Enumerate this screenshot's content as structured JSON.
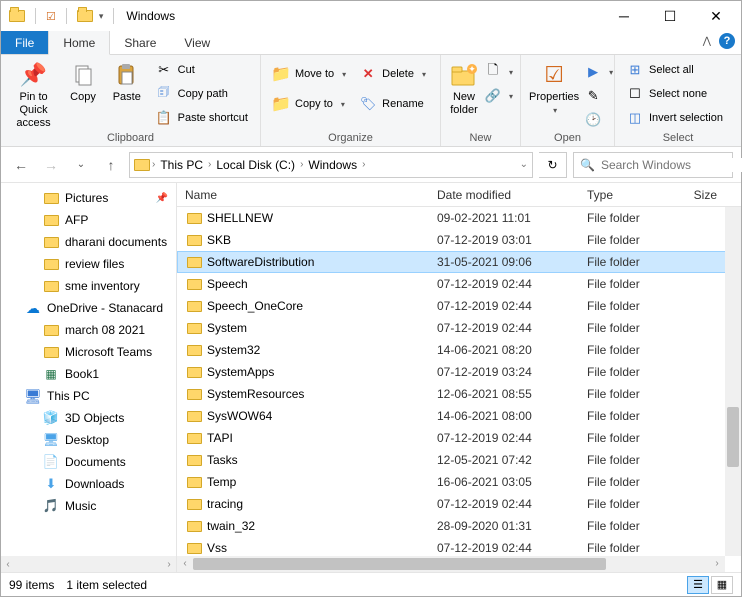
{
  "window": {
    "title": "Windows"
  },
  "tabs": {
    "file": "File",
    "home": "Home",
    "share": "Share",
    "view": "View"
  },
  "ribbon": {
    "clipboard": {
      "label": "Clipboard",
      "pin": "Pin to Quick access",
      "copy": "Copy",
      "paste": "Paste",
      "cut": "Cut",
      "copy_path": "Copy path",
      "paste_shortcut": "Paste shortcut"
    },
    "organize": {
      "label": "Organize",
      "move_to": "Move to",
      "copy_to": "Copy to",
      "delete": "Delete",
      "rename": "Rename"
    },
    "new": {
      "label": "New",
      "new_folder": "New folder"
    },
    "open": {
      "label": "Open",
      "properties": "Properties"
    },
    "select": {
      "label": "Select",
      "select_all": "Select all",
      "select_none": "Select none",
      "invert": "Invert selection"
    }
  },
  "breadcrumb": {
    "this_pc": "This PC",
    "local_disk": "Local Disk (C:)",
    "windows": "Windows"
  },
  "search": {
    "placeholder": "Search Windows"
  },
  "sidebar": {
    "items": [
      {
        "label": "Pictures",
        "icon": "folder",
        "level": 2,
        "pinned": true
      },
      {
        "label": "AFP",
        "icon": "folder",
        "level": 2
      },
      {
        "label": "dharani documents",
        "icon": "folder",
        "level": 2
      },
      {
        "label": "review files",
        "icon": "folder",
        "level": 2
      },
      {
        "label": "sme inventory",
        "icon": "folder",
        "level": 2
      },
      {
        "label": "OneDrive - Stanacard",
        "icon": "onedrive",
        "level": 1
      },
      {
        "label": "march 08 2021",
        "icon": "folder",
        "level": 2
      },
      {
        "label": "Microsoft Teams",
        "icon": "folder",
        "level": 2
      },
      {
        "label": "Book1",
        "icon": "excel",
        "level": 2
      },
      {
        "label": "This PC",
        "icon": "pc",
        "level": 1
      },
      {
        "label": "3D Objects",
        "icon": "3d",
        "level": 2
      },
      {
        "label": "Desktop",
        "icon": "desktop",
        "level": 2
      },
      {
        "label": "Documents",
        "icon": "documents",
        "level": 2
      },
      {
        "label": "Downloads",
        "icon": "downloads",
        "level": 2
      },
      {
        "label": "Music",
        "icon": "music",
        "level": 2
      }
    ]
  },
  "columns": {
    "name": "Name",
    "date": "Date modified",
    "type": "Type",
    "size": "Size"
  },
  "files": [
    {
      "name": "SHELLNEW",
      "date": "09-02-2021 11:01",
      "type": "File folder",
      "selected": false
    },
    {
      "name": "SKB",
      "date": "07-12-2019 03:01",
      "type": "File folder",
      "selected": false
    },
    {
      "name": "SoftwareDistribution",
      "date": "31-05-2021 09:06",
      "type": "File folder",
      "selected": true
    },
    {
      "name": "Speech",
      "date": "07-12-2019 02:44",
      "type": "File folder",
      "selected": false
    },
    {
      "name": "Speech_OneCore",
      "date": "07-12-2019 02:44",
      "type": "File folder",
      "selected": false
    },
    {
      "name": "System",
      "date": "07-12-2019 02:44",
      "type": "File folder",
      "selected": false
    },
    {
      "name": "System32",
      "date": "14-06-2021 08:20",
      "type": "File folder",
      "selected": false
    },
    {
      "name": "SystemApps",
      "date": "07-12-2019 03:24",
      "type": "File folder",
      "selected": false
    },
    {
      "name": "SystemResources",
      "date": "12-06-2021 08:55",
      "type": "File folder",
      "selected": false
    },
    {
      "name": "SysWOW64",
      "date": "14-06-2021 08:00",
      "type": "File folder",
      "selected": false
    },
    {
      "name": "TAPI",
      "date": "07-12-2019 02:44",
      "type": "File folder",
      "selected": false
    },
    {
      "name": "Tasks",
      "date": "12-05-2021 07:42",
      "type": "File folder",
      "selected": false
    },
    {
      "name": "Temp",
      "date": "16-06-2021 03:05",
      "type": "File folder",
      "selected": false
    },
    {
      "name": "tracing",
      "date": "07-12-2019 02:44",
      "type": "File folder",
      "selected": false
    },
    {
      "name": "twain_32",
      "date": "28-09-2020 01:31",
      "type": "File folder",
      "selected": false
    },
    {
      "name": "Vss",
      "date": "07-12-2019 02:44",
      "type": "File folder",
      "selected": false
    }
  ],
  "status": {
    "count": "99 items",
    "selected": "1 item selected"
  }
}
